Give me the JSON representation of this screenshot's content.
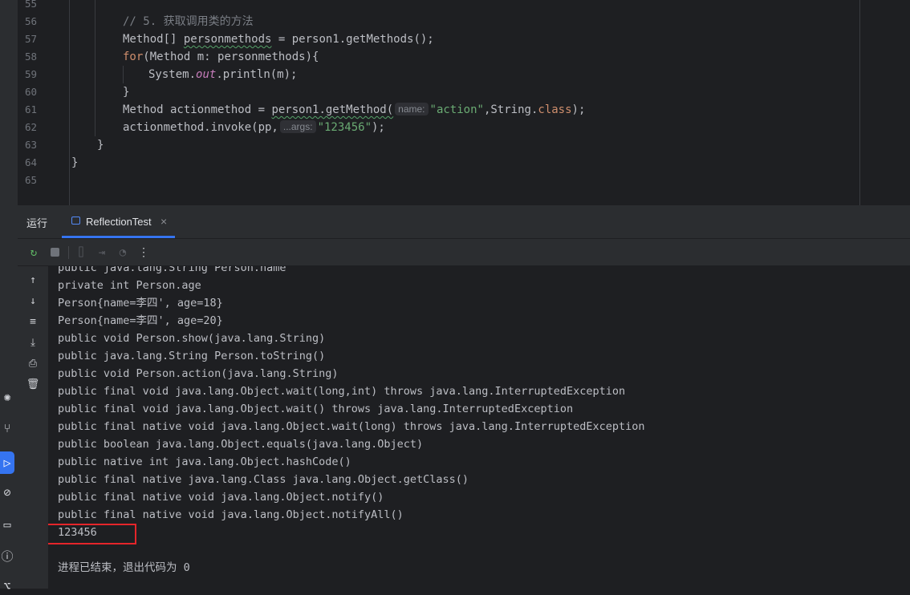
{
  "editor": {
    "line_numbers": [
      "55",
      "56",
      "57",
      "58",
      "59",
      "60",
      "61",
      "62",
      "63",
      "64",
      "65"
    ],
    "lines": {
      "l56_comment": "// 5. 获取调用类的方法",
      "l57_a": "Method[] ",
      "l57_var": "personmethods",
      "l57_b": " = person1.getMethods();",
      "l58_kw": "for",
      "l58_rest": "(Method m: personmethods){",
      "l59_a": "System.",
      "l59_field": "out",
      "l59_b": ".println(m);",
      "l60": "}",
      "l61_a": "Method actionmethod = ",
      "l61_call": "person1.getMethod(",
      "l61_hint": "name:",
      "l61_str": "\"action\"",
      "l61_b": ",String.",
      "l61_kw": "class",
      "l61_c": ");",
      "l62_a": "actionmethod.invoke(pp,",
      "l62_hint": "...args:",
      "l62_str": "\"123456\"",
      "l62_b": ");",
      "l63": "}",
      "l64": "}"
    }
  },
  "run_panel": {
    "title": "运行",
    "tab_label": "ReflectionTest",
    "tab_close": "×"
  },
  "toolbar": {
    "icons": [
      "rerun-icon",
      "stop-icon",
      "camera-icon",
      "exit-icon",
      "profiler-icon",
      "more-icon"
    ]
  },
  "console": {
    "lines": [
      "public java.lang.String Person.name",
      "private int Person.age",
      "Person{name=李四', age=18}",
      "Person{name=李四', age=20}",
      "public void Person.show(java.lang.String)",
      "public java.lang.String Person.toString()",
      "public void Person.action(java.lang.String)",
      "public final void java.lang.Object.wait(long,int) throws java.lang.InterruptedException",
      "public final void java.lang.Object.wait() throws java.lang.InterruptedException",
      "public final native void java.lang.Object.wait(long) throws java.lang.InterruptedException",
      "public boolean java.lang.Object.equals(java.lang.Object)",
      "public native int java.lang.Object.hashCode()",
      "public final native java.lang.Class java.lang.Object.getClass()",
      "public final native void java.lang.Object.notify()",
      "public final native void java.lang.Object.notifyAll()",
      "123456",
      "",
      "进程已结束，退出代码为 0"
    ]
  },
  "colors": {
    "accent": "#3574f0",
    "highlight_box": "#e5252a"
  }
}
